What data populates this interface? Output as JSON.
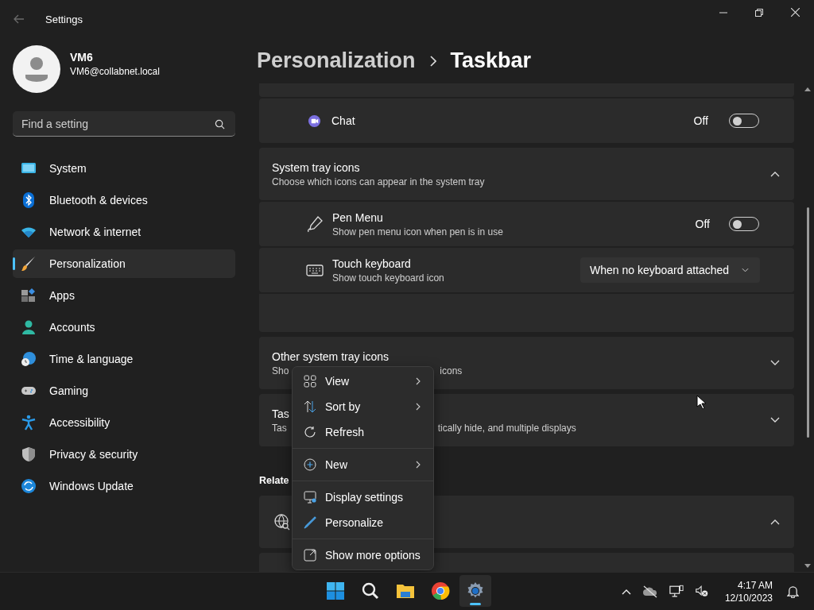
{
  "window": {
    "title": "Settings"
  },
  "user": {
    "name": "VM6",
    "email": "VM6@collabnet.local"
  },
  "search": {
    "placeholder": "Find a setting"
  },
  "nav": [
    {
      "label": "System",
      "selected": false
    },
    {
      "label": "Bluetooth & devices",
      "selected": false
    },
    {
      "label": "Network & internet",
      "selected": false
    },
    {
      "label": "Personalization",
      "selected": true
    },
    {
      "label": "Apps",
      "selected": false
    },
    {
      "label": "Accounts",
      "selected": false
    },
    {
      "label": "Time & language",
      "selected": false
    },
    {
      "label": "Gaming",
      "selected": false
    },
    {
      "label": "Accessibility",
      "selected": false
    },
    {
      "label": "Privacy & security",
      "selected": false
    },
    {
      "label": "Windows Update",
      "selected": false
    }
  ],
  "breadcrumb": {
    "parent": "Personalization",
    "current": "Taskbar"
  },
  "chat_row": {
    "kind": "toggle",
    "label": "Chat",
    "state_text": "Off",
    "on": false
  },
  "groups": [
    {
      "title": "System tray icons",
      "subtitle": "Choose which icons can appear in the system tray",
      "expanded": true,
      "rows": [
        {
          "kind": "toggle",
          "label": "Pen Menu",
          "description": "Show pen menu icon when pen is in use",
          "state_text": "Off",
          "on": false
        },
        {
          "kind": "dropdown",
          "label": "Touch keyboard",
          "description": "Show touch keyboard icon",
          "value": "When no keyboard attached"
        }
      ]
    },
    {
      "title": "Other system tray icons",
      "subtitle_parts": [
        "Sho",
        "icons"
      ],
      "expanded": false
    },
    {
      "title": "Tas",
      "subtitle_parts": [
        "Tas",
        "tically hide, and multiple displays"
      ],
      "expanded": false
    }
  ],
  "related": {
    "heading": "Relate",
    "expanded": true
  },
  "context_menu": {
    "groups": [
      [
        {
          "label": "View",
          "submenu": true
        },
        {
          "label": "Sort by",
          "submenu": true
        },
        {
          "label": "Refresh",
          "submenu": false
        }
      ],
      [
        {
          "label": "New",
          "submenu": true
        }
      ],
      [
        {
          "label": "Display settings",
          "submenu": false
        },
        {
          "label": "Personalize",
          "submenu": false
        }
      ],
      [
        {
          "label": "Show more options",
          "submenu": false
        }
      ]
    ]
  },
  "taskbar": {
    "apps": [
      {
        "selected": false
      },
      {
        "selected": false
      },
      {
        "selected": false
      },
      {
        "selected": false
      },
      {
        "selected": true
      }
    ],
    "time": "4:17 AM",
    "date": "12/10/2023"
  }
}
